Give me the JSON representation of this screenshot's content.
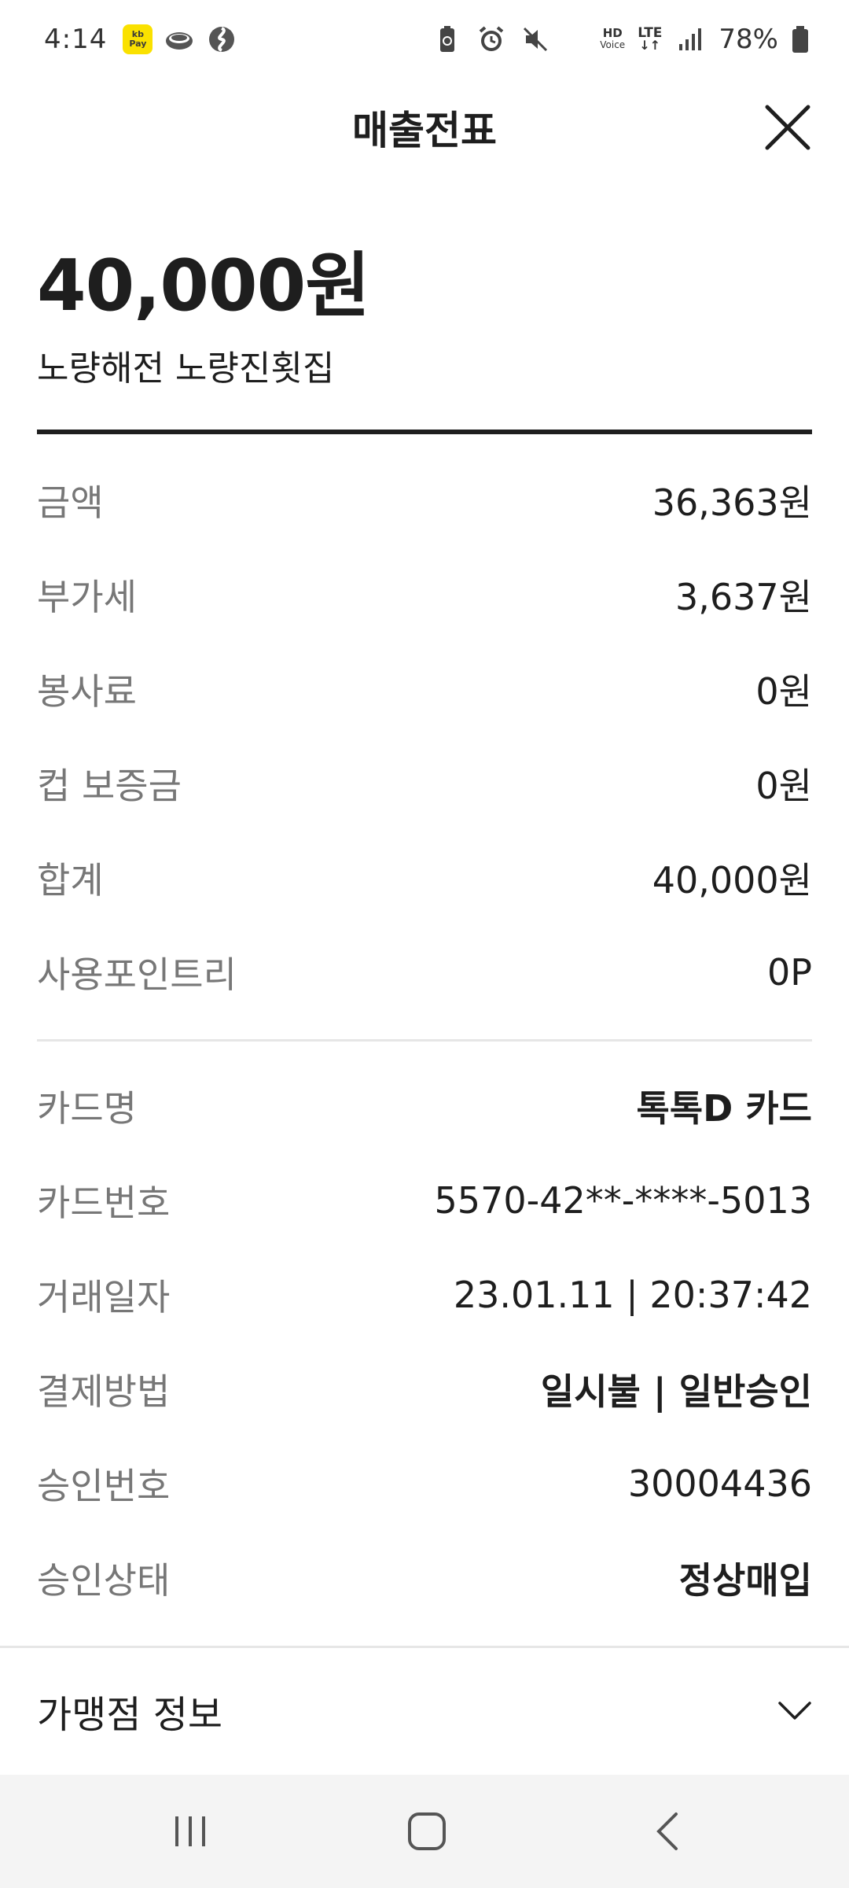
{
  "status_bar": {
    "time": "4:14",
    "pay_badge_top": "kb",
    "pay_badge_bottom": "Pay",
    "hd_line1": "HD",
    "hd_line2": "Voice",
    "lte": "LTE",
    "battery": "78%"
  },
  "header": {
    "title": "매출전표"
  },
  "summary": {
    "total_amount": "40,000원",
    "merchant_name": "노량해전 노량진횟집"
  },
  "amount_rows": [
    {
      "label": "금액",
      "value": "36,363원"
    },
    {
      "label": "부가세",
      "value": "3,637원"
    },
    {
      "label": "봉사료",
      "value": "0원"
    },
    {
      "label": "컵 보증금",
      "value": "0원"
    },
    {
      "label": "합계",
      "value": "40,000원"
    },
    {
      "label": "사용포인트리",
      "value": "0P"
    }
  ],
  "card_rows": [
    {
      "label": "카드명",
      "value": "톡톡D 카드"
    },
    {
      "label": "카드번호",
      "value": "5570-42**-****-5013"
    },
    {
      "label": "거래일자",
      "value": "23.01.11 | 20:37:42"
    },
    {
      "label": "결제방법",
      "value": "일시불 | 일반승인"
    },
    {
      "label": "승인번호",
      "value": "30004436"
    },
    {
      "label": "승인상태",
      "value": "정상매입"
    }
  ],
  "merchant_info": {
    "label": "가맹점 정보"
  },
  "colors": {
    "text": "#1e1e1e",
    "label": "#777777",
    "divider": "#e6e6e6",
    "pay_badge": "#fae100",
    "navbar": "#f4f4f4"
  },
  "icons": [
    "close-icon",
    "chevron-down-icon",
    "recent-apps-icon",
    "home-icon",
    "back-icon"
  ]
}
